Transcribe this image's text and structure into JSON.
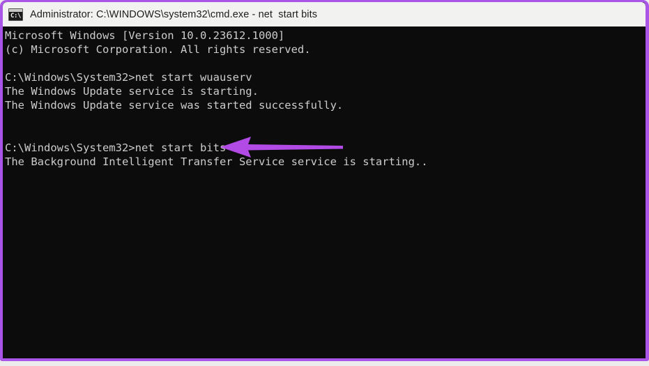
{
  "window": {
    "title": "Administrator: C:\\WINDOWS\\system32\\cmd.exe - net  start bits",
    "icon": "cmd-console-icon",
    "icon_glyph": "C:\\.",
    "border_color": "#a855e8",
    "titlebar_color": "#f2f2f0"
  },
  "terminal": {
    "background_color": "#0c0c0c",
    "text_color": "#cccccc",
    "content": "Microsoft Windows [Version 10.0.23612.1000]\n(c) Microsoft Corporation. All rights reserved.\n\nC:\\Windows\\System32>net start wuauserv\nThe Windows Update service is starting.\nThe Windows Update service was started successfully.\n\n\nC:\\Windows\\System32>net start bits\nThe Background Intelligent Transfer Service service is starting..",
    "lines": [
      "Microsoft Windows [Version 10.0.23612.1000]",
      "(c) Microsoft Corporation. All rights reserved.",
      "",
      "C:\\Windows\\System32>net start wuauserv",
      "The Windows Update service is starting.",
      "The Windows Update service was started successfully.",
      "",
      "",
      "C:\\Windows\\System32>net start bits",
      "The Background Intelligent Transfer Service service is starting.."
    ],
    "os_version": "10.0.23612.1000",
    "prompt_path": "C:\\Windows\\System32>",
    "commands": [
      "net start wuauserv",
      "net start bits"
    ]
  },
  "annotation": {
    "type": "arrow",
    "direction": "left",
    "color": "#b24be6",
    "points_at": "net start bits"
  }
}
